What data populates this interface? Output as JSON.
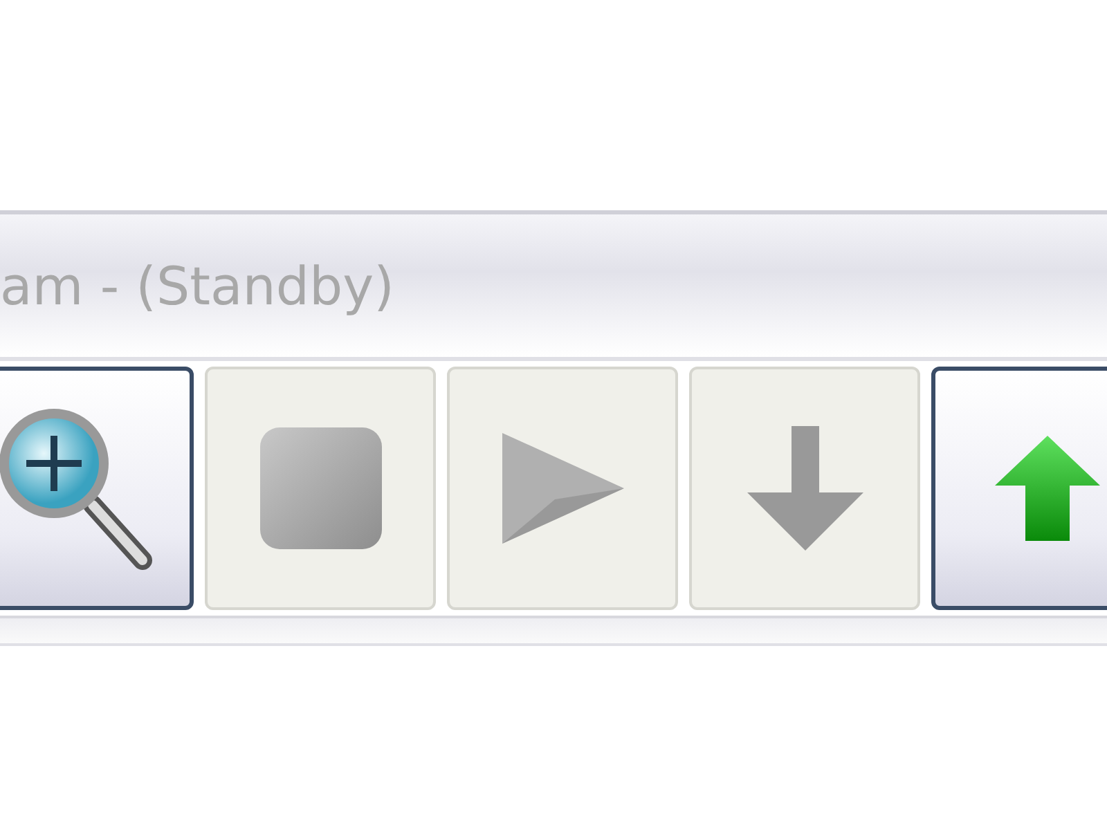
{
  "window": {
    "title": "am - (Standby)"
  },
  "toolbar": [
    {
      "kind": "zoom",
      "disabled": false
    },
    {
      "kind": "stop",
      "disabled": true
    },
    {
      "kind": "play",
      "disabled": true
    },
    {
      "kind": "download",
      "disabled": true
    },
    {
      "kind": "upload",
      "disabled": false
    }
  ]
}
